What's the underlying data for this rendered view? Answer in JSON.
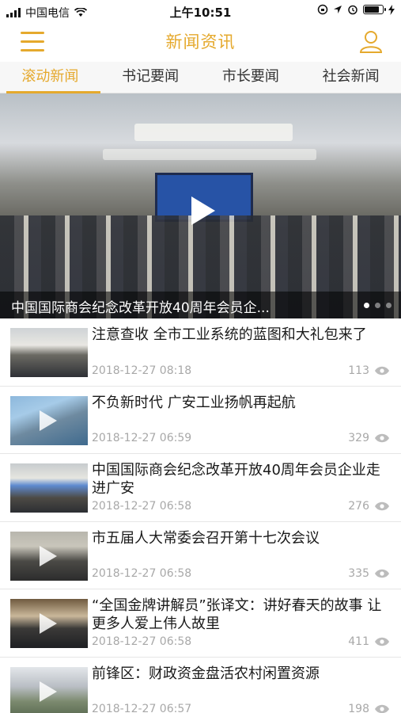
{
  "status_bar": {
    "carrier": "中国电信",
    "time": "上午10:51",
    "battery_level": 0.85
  },
  "header": {
    "title": "新闻资讯",
    "accent_color": "#e5a92d"
  },
  "tabs": [
    {
      "label": "滚动新闻",
      "active": true
    },
    {
      "label": "书记要闻",
      "active": false
    },
    {
      "label": "市长要闻",
      "active": false
    },
    {
      "label": "社会新闻",
      "active": false
    }
  ],
  "banner": {
    "caption": "中国国际商会纪念改革开放40周年会员企...",
    "slide_count": 3,
    "active_slide": 1
  },
  "news": [
    {
      "title": "注意查收 全市工业系统的蓝图和大礼包来了",
      "date": "2018-12-27 08:18",
      "views": "113",
      "video": false
    },
    {
      "title": "不负新时代 广安工业扬帆再起航",
      "date": "2018-12-27 06:59",
      "views": "329",
      "video": true
    },
    {
      "title": "中国国际商会纪念改革开放40周年会员企业走进广安",
      "date": "2018-12-27 06:58",
      "views": "276",
      "video": false
    },
    {
      "title": "市五届人大常委会召开第十七次会议",
      "date": "2018-12-27 06:58",
      "views": "335",
      "video": true
    },
    {
      "title": "“全国金牌讲解员”张译文：讲好春天的故事 让更多人爱上伟人故里",
      "date": "2018-12-27 06:58",
      "views": "411",
      "video": true
    },
    {
      "title": "前锋区：财政资金盘活农村闲置资源",
      "date": "2018-12-27 06:57",
      "views": "198",
      "video": true
    }
  ]
}
